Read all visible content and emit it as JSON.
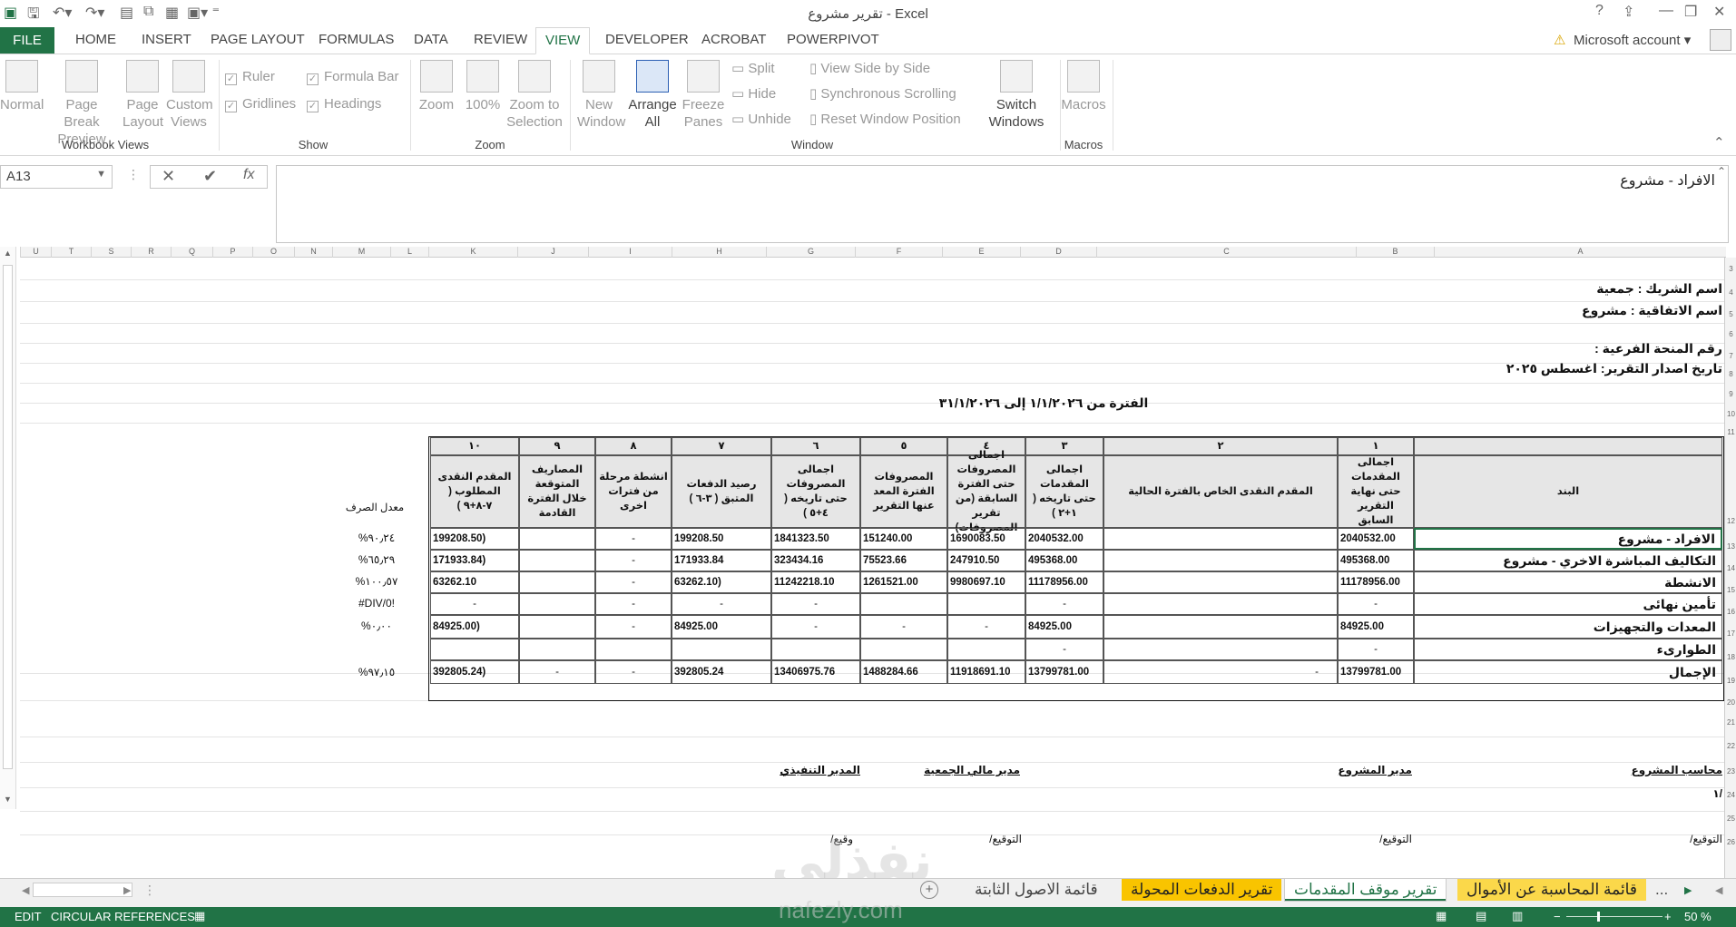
{
  "window": {
    "title": "تقرير مشروع - Excel"
  },
  "ribbon_tabs": [
    "FILE",
    "HOME",
    "INSERT",
    "PAGE LAYOUT",
    "FORMULAS",
    "DATA",
    "REVIEW",
    "VIEW",
    "DEVELOPER",
    "ACROBAT",
    "POWERPIVOT"
  ],
  "account": "Microsoft account",
  "ribbon": {
    "workbook_views": {
      "normal": "Normal",
      "page_break": "Page Break Preview",
      "page_layout": "Page Layout",
      "custom_views": "Custom Views",
      "group": "Workbook Views"
    },
    "show": {
      "ruler": "Ruler",
      "formula_bar": "Formula Bar",
      "gridlines": "Gridlines",
      "headings": "Headings",
      "group": "Show"
    },
    "zoom": {
      "zoom": "Zoom",
      "z100": "100%",
      "zoom_sel": "Zoom to Selection",
      "group": "Zoom"
    },
    "window": {
      "new_window": "New Window",
      "arrange_all": "Arrange All",
      "freeze": "Freeze Panes",
      "split": "Split",
      "hide": "Hide",
      "unhide": "Unhide",
      "side_by_side": "View Side by Side",
      "sync_scroll": "Synchronous Scrolling",
      "reset_pos": "Reset Window Position",
      "switch": "Switch Windows",
      "group": "Window"
    },
    "macros": {
      "macros": "Macros",
      "group": "Macros"
    }
  },
  "formula_bar": {
    "name_box": "A13",
    "value": "الافراد - مشروع"
  },
  "columns": [
    "U",
    "T",
    "S",
    "R",
    "Q",
    "P",
    "O",
    "N",
    "M",
    "L",
    "K",
    "J",
    "I",
    "H",
    "G",
    "F",
    "E",
    "D",
    "C",
    "B",
    "A"
  ],
  "rows": [
    "3",
    "4",
    "5",
    "6",
    "7",
    "8",
    "9",
    "10",
    "11",
    "12",
    "13",
    "14",
    "15",
    "16",
    "17",
    "18",
    "19",
    "20",
    "21",
    "22",
    "23",
    "24",
    "25",
    "26"
  ],
  "sheet": {
    "partner": "اسم الشريك : جمعية",
    "agreement": "اسم الاتفاقية : مشروع",
    "subgrant": "رقم المنحة الفرعية :",
    "issue_date": "تاريخ اصدار التقرير: اغسطس ٢٠٢٥",
    "period": "الفترة من ١/١/٢٠٢٦  إلى ٣١/١/٢٠٢٦",
    "exchange_rate_label": "معدل الصرف",
    "col_numbers": [
      "١",
      "٢",
      "٣",
      "٤",
      "٥",
      "٦",
      "٧",
      "٨",
      "٩",
      "١٠"
    ],
    "col_headers": {
      "item": "البند",
      "c1": "اجمالى المقدمات حتى نهاية التقرير السابق",
      "c2": "المقدم  النقدى الخاص بالفترة الحالية",
      "c3": "اجمالى المقدمات حتى تاريخه ( ١+٢ )",
      "c4": "اجمالى المصروفات حتى الفترة السابقة (من تقرير المصروفات)",
      "c5": "المصروفات الفترة المعد عنها التقرير",
      "c6": "اجمالى المصروفات حتى تاريخه ( ٤+٥ )",
      "c7": "رصيد الدفعات  المتبق ( ٣-٦ )",
      "c8": "انشطة مرحلة من فترات اخرى",
      "c9": "المصاريف المتوقعة  خلال الفترة القادمة",
      "c10": "المقدم النقدى المطلوب ( ٧-٨+٩ )"
    },
    "rows": [
      {
        "item": "الافراد - مشروع",
        "c1": "2040532.00",
        "c2": "",
        "c3": "2040532.00",
        "c4": "1690083.50",
        "c5": "151240.00",
        "c6": "1841323.50",
        "c7": "199208.50",
        "c8": "-",
        "c9": "",
        "c10": "199208.50)",
        "rate": "%٩٠٫٢٤"
      },
      {
        "item": "التكاليف المباشرة الاخري - مشروع",
        "c1": "495368.00",
        "c2": "",
        "c3": "495368.00",
        "c4": "247910.50",
        "c5": "75523.66",
        "c6": "323434.16",
        "c7": "171933.84",
        "c8": "-",
        "c9": "",
        "c10": "171933.84)",
        "rate": "%٦٥٫٢٩"
      },
      {
        "item": "الانشطة",
        "c1": "11178956.00",
        "c2": "",
        "c3": "11178956.00",
        "c4": "9980697.10",
        "c5": "1261521.00",
        "c6": "11242218.10",
        "c7": "63262.10)",
        "c8": "-",
        "c9": "",
        "c10": "63262.10",
        "rate": "%١٠٠٫٥٧"
      },
      {
        "item": "تأمين نهائى",
        "c1": "-",
        "c2": "",
        "c3": "-",
        "c4": "",
        "c5": "",
        "c6": "-",
        "c7": "-",
        "c8": "-",
        "c9": "",
        "c10": "-",
        "rate": "#DIV/0!"
      },
      {
        "item": "المعدات والتجهيزات",
        "c1": "84925.00",
        "c2": "",
        "c3": "84925.00",
        "c4": "-",
        "c5": "-",
        "c6": "-",
        "c7": "84925.00",
        "c8": "-",
        "c9": "",
        "c10": "84925.00)",
        "rate": "%٠٫٠٠"
      },
      {
        "item": "الطوارىء",
        "c1": "-",
        "c2": "",
        "c3": "-",
        "c4": "",
        "c5": "",
        "c6": "",
        "c7": "",
        "c8": "",
        "c9": "",
        "c10": "",
        "rate": ""
      },
      {
        "item": "الإجمال",
        "c1": "13799781.00",
        "c2": "-",
        "c3": "13799781.00",
        "c4": "11918691.10",
        "c5": "1488284.66",
        "c6": "13406975.76",
        "c7": "392805.24",
        "c8": "-",
        "c9": "-",
        "c10": "392805.24)",
        "rate": "%٩٧٫١٥"
      }
    ],
    "signatures": {
      "accountant": "محاسب المشروع",
      "manager": "مدير المشروع",
      "finance": "مدير مالي الجمعية",
      "exec": "المدير التنفيذي",
      "slash": "/١",
      "sign1": "التوقيع/",
      "sign2": "التوقيع/",
      "sign3": "التوقيع/",
      "sign4": "وقيع/"
    }
  },
  "sheet_tabs": [
    "...",
    "قائمة المحاسبة عن الأموال",
    "تقرير موقف المقدمات",
    "تقرير الدفعات المحولة",
    "قائمة الاصول الثابتة"
  ],
  "status": {
    "mode": "EDIT",
    "circ": "CIRCULAR REFERENCES",
    "zoom": "50 %"
  },
  "watermark": {
    "logo": "نفذلي",
    "url": "nafezly.com"
  },
  "colors": {
    "accent": "#217346",
    "tab_yellow": "#f9c400",
    "tab_yellow2": "#fbd84a"
  }
}
